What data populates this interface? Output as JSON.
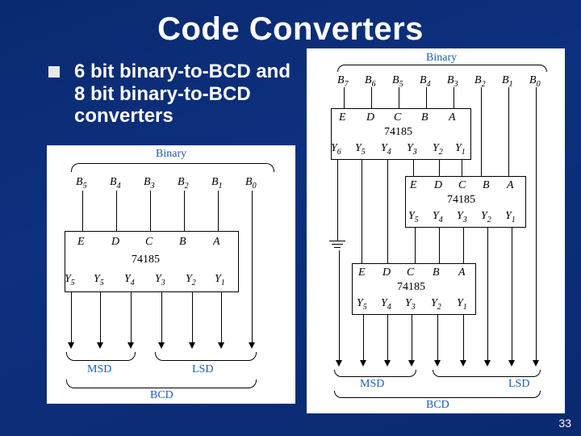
{
  "slide": {
    "title": "Code Converters",
    "body": "6 bit binary-to-BCD and 8 bit binary-to-BCD converters",
    "page_number": "33"
  },
  "fig6": {
    "top_label": "Binary",
    "inputs": [
      "B5",
      "B4",
      "B3",
      "B2",
      "B1",
      "B0"
    ],
    "chip_inputs": [
      "E",
      "D",
      "C",
      "B",
      "A"
    ],
    "chip_name": "74185",
    "chip_outputs": [
      "Y5",
      "Y5",
      "Y4",
      "Y3",
      "Y2",
      "Y1"
    ],
    "msd": "MSD",
    "lsd": "LSD",
    "bottom_label": "BCD"
  },
  "fig8": {
    "top_label": "Binary",
    "inputs": [
      "B7",
      "B6",
      "B5",
      "B4",
      "B3",
      "B2",
      "B1",
      "B0"
    ],
    "chip_inputs": [
      "E",
      "D",
      "C",
      "B",
      "A"
    ],
    "chip_name": "74185",
    "chip_outputs6": [
      "Y6",
      "Y5",
      "Y4",
      "Y3",
      "Y2",
      "Y1"
    ],
    "chip_outputs5": [
      "Y5",
      "Y4",
      "Y3",
      "Y2",
      "Y1"
    ],
    "msd": "MSD",
    "lsd": "LSD",
    "bottom_label": "BCD"
  }
}
